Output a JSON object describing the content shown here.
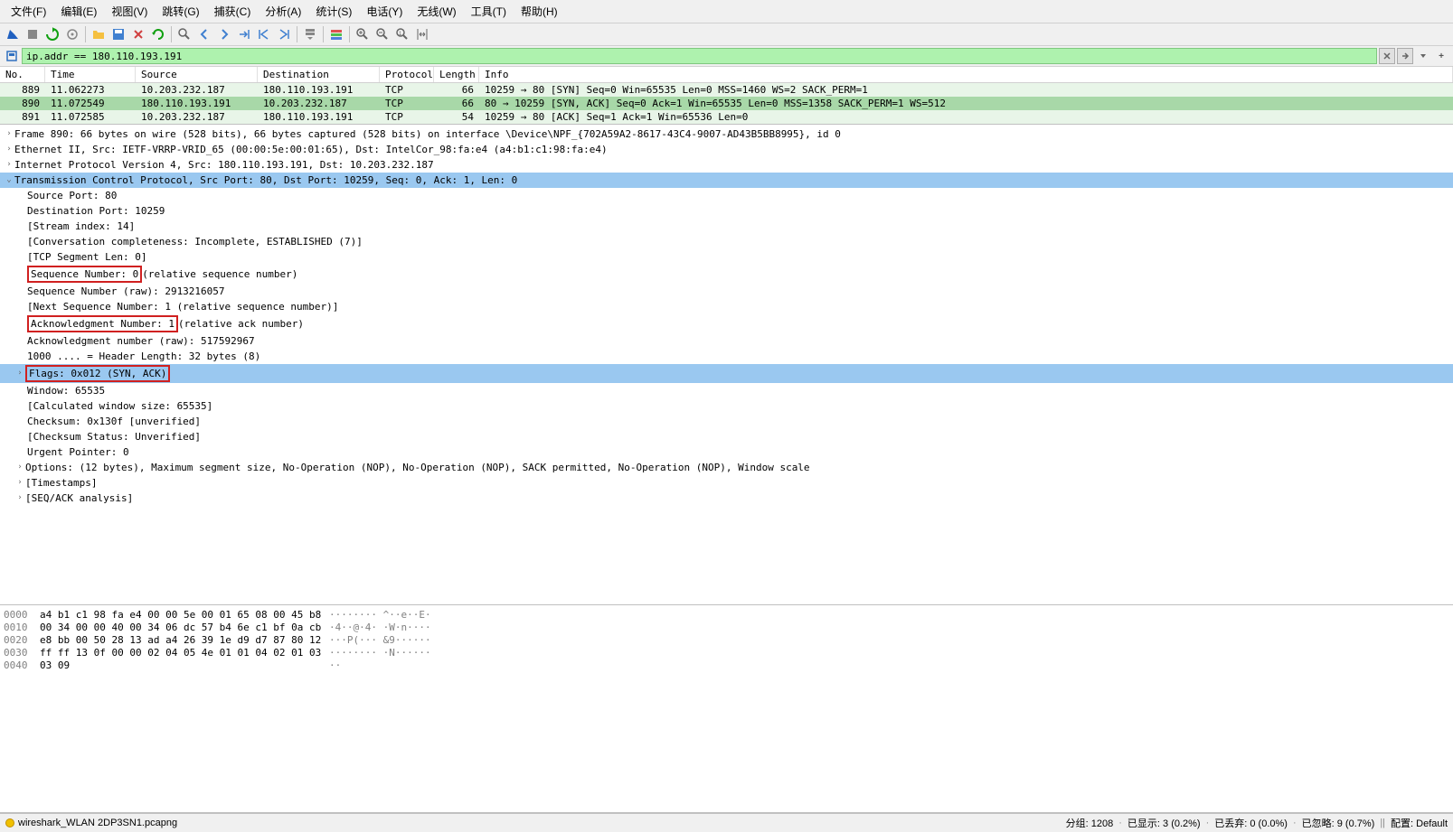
{
  "menu": {
    "file": "文件(F)",
    "edit": "编辑(E)",
    "view": "视图(V)",
    "go": "跳转(G)",
    "capture": "捕获(C)",
    "analyze": "分析(A)",
    "statistics": "统计(S)",
    "telephony": "电话(Y)",
    "wireless": "无线(W)",
    "tools": "工具(T)",
    "help": "帮助(H)"
  },
  "filter": {
    "value": "ip.addr == 180.110.193.191"
  },
  "columns": {
    "no": "No.",
    "time": "Time",
    "source": "Source",
    "destination": "Destination",
    "protocol": "Protocol",
    "length": "Length",
    "info": "Info"
  },
  "packets": [
    {
      "no": "889",
      "time": "11.062273",
      "src": "10.203.232.187",
      "dst": "180.110.193.191",
      "proto": "TCP",
      "len": "66",
      "info": "10259 → 80 [SYN] Seq=0 Win=65535 Len=0 MSS=1460 WS=2 SACK_PERM=1",
      "cls": "light-green"
    },
    {
      "no": "890",
      "time": "11.072549",
      "src": "180.110.193.191",
      "dst": "10.203.232.187",
      "proto": "TCP",
      "len": "66",
      "info": "80 → 10259 [SYN, ACK] Seq=0 Ack=1 Win=65535 Len=0 MSS=1358 SACK_PERM=1 WS=512",
      "cls": "selected"
    },
    {
      "no": "891",
      "time": "11.072585",
      "src": "10.203.232.187",
      "dst": "180.110.193.191",
      "proto": "TCP",
      "len": "54",
      "info": "10259 → 80 [ACK] Seq=1 Ack=1 Win=65536 Len=0",
      "cls": "light-green"
    }
  ],
  "details": {
    "frame": "Frame 890: 66 bytes on wire (528 bits), 66 bytes captured (528 bits) on interface \\Device\\NPF_{702A59A2-8617-43C4-9007-AD43B5BB8995}, id 0",
    "ethernet": "Ethernet II, Src: IETF-VRRP-VRID_65 (00:00:5e:00:01:65), Dst: IntelCor_98:fa:e4 (a4:b1:c1:98:fa:e4)",
    "ip": "Internet Protocol Version 4, Src: 180.110.193.191, Dst: 10.203.232.187",
    "tcp": "Transmission Control Protocol, Src Port: 80, Dst Port: 10259, Seq: 0, Ack: 1, Len: 0",
    "src_port": "Source Port: 80",
    "dst_port": "Destination Port: 10259",
    "stream": "[Stream index: 14]",
    "completeness": "[Conversation completeness: Incomplete, ESTABLISHED (7)]",
    "seg_len": "[TCP Segment Len: 0]",
    "seq_num": "Sequence Number: 0",
    "seq_suffix": "    (relative sequence number)",
    "seq_raw": "Sequence Number (raw): 2913216057",
    "next_seq": "[Next Sequence Number: 1    (relative sequence number)]",
    "ack_num": "Acknowledgment Number: 1",
    "ack_suffix": "    (relative ack number)",
    "ack_raw": "Acknowledgment number (raw): 517592967",
    "header_len": "1000 .... = Header Length: 32 bytes (8)",
    "flags": "Flags: 0x012 (SYN, ACK)",
    "window": "Window: 65535",
    "calc_window": "[Calculated window size: 65535]",
    "checksum": "Checksum: 0x130f [unverified]",
    "checksum_status": "[Checksum Status: Unverified]",
    "urgent": "Urgent Pointer: 0",
    "options": "Options: (12 bytes), Maximum segment size, No-Operation (NOP), No-Operation (NOP), SACK permitted, No-Operation (NOP), Window scale",
    "timestamps": "[Timestamps]",
    "seq_ack": "[SEQ/ACK analysis]"
  },
  "hex": [
    {
      "offset": "0000",
      "bytes": "a4 b1 c1 98 fa e4 00 00  5e 00 01 65 08 00 45 b8",
      "ascii": "········ ^··e··E·"
    },
    {
      "offset": "0010",
      "bytes": "00 34 00 00 40 00 34 06  dc 57 b4 6e c1 bf 0a cb",
      "ascii": "·4··@·4· ·W·n····"
    },
    {
      "offset": "0020",
      "bytes": "e8 bb 00 50 28 13 ad a4  26 39 1e d9 d7 87 80 12",
      "ascii": "···P(··· &9······"
    },
    {
      "offset": "0030",
      "bytes": "ff ff 13 0f 00 00 02 04  05 4e 01 01 04 02 01 03",
      "ascii": "········ ·N······"
    },
    {
      "offset": "0040",
      "bytes": "03 09",
      "ascii": "··"
    }
  ],
  "status": {
    "file": "wireshark_WLAN 2DP3SN1.pcapng",
    "packets": "分组: 1208",
    "displayed": "已显示: 3 (0.2%)",
    "dropped": "已丢弃: 0 (0.0%)",
    "ignored": "已忽略: 9 (0.7%)",
    "profile": "配置: Default"
  }
}
